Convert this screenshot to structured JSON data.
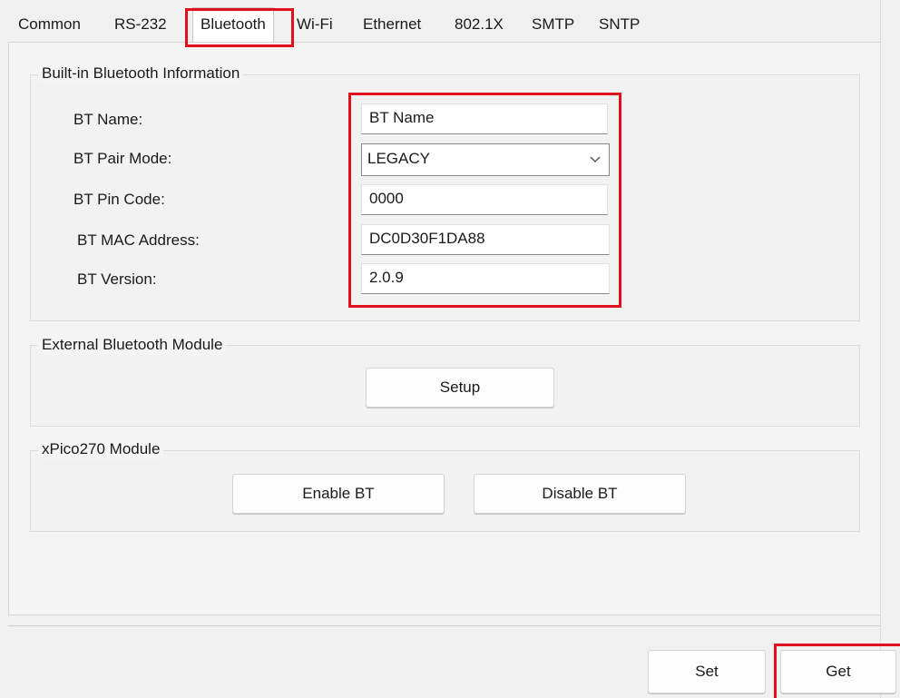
{
  "tabs": [
    {
      "label": "Common"
    },
    {
      "label": "RS-232"
    },
    {
      "label": "Bluetooth"
    },
    {
      "label": "Wi-Fi"
    },
    {
      "label": "Ethernet"
    },
    {
      "label": "802.1X"
    },
    {
      "label": "SMTP"
    },
    {
      "label": "SNTP"
    }
  ],
  "builtin": {
    "title": "Built-in Bluetooth Information",
    "bt_name_label": "BT Name:",
    "bt_name_value": "BT Name",
    "pair_mode_label": "BT Pair Mode:",
    "pair_mode_value": "LEGACY",
    "pin_label": "BT Pin Code:",
    "pin_value": "0000",
    "mac_label": "BT MAC Address:",
    "mac_value": "DC0D30F1DA88",
    "version_label": "BT Version:",
    "version_value": "2.0.9"
  },
  "external": {
    "title": "External Bluetooth Module",
    "setup_label": "Setup"
  },
  "xpico": {
    "title": "xPico270 Module",
    "enable_label": "Enable BT",
    "disable_label": "Disable BT"
  },
  "footer": {
    "set_label": "Set",
    "get_label": "Get"
  },
  "colors": {
    "highlight": "#e0101d"
  },
  "icons": {
    "dropdown": "chevron-down-icon"
  }
}
